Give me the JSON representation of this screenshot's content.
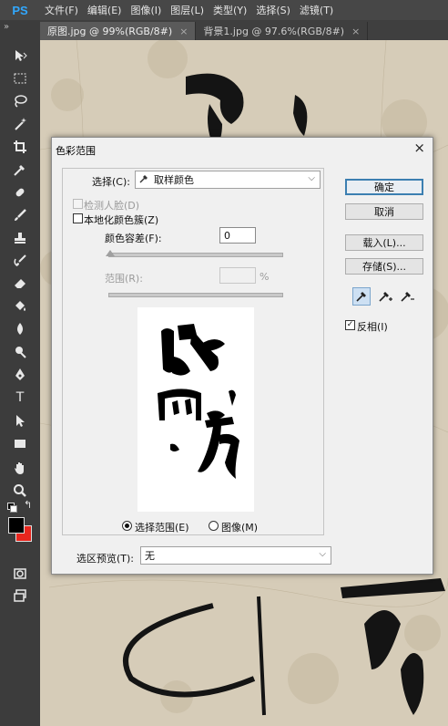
{
  "app": {
    "logo": "PS",
    "menu": [
      "文件(F)",
      "编辑(E)",
      "图像(I)",
      "图层(L)",
      "类型(Y)",
      "选择(S)",
      "滤镜(T)"
    ]
  },
  "tabs": [
    {
      "label": "原图.jpg @ 99%(RGB/8#)",
      "close": "×",
      "active": true
    },
    {
      "label": "背景1.jpg @ 97.6%(RGB/8#)",
      "close": "×",
      "active": false
    }
  ],
  "toolbar": {
    "expand": "»",
    "tools": [
      "move-tool",
      "marquee-tool",
      "lasso-tool",
      "magic-wand-tool",
      "crop-tool",
      "eyedropper-tool",
      "healing-brush-tool",
      "brush-tool",
      "clone-stamp-tool",
      "history-brush-tool",
      "eraser-tool",
      "paint-bucket-tool",
      "blur-tool",
      "dodge-tool",
      "pen-tool",
      "type-tool",
      "path-selection-tool",
      "rectangle-tool",
      "hand-tool",
      "zoom-tool"
    ],
    "type_glyph": "T",
    "foreground_color": "#000000",
    "background_color": "#e8261e"
  },
  "dialog": {
    "title": "色彩范围",
    "close": "×",
    "select_label": "选择(C):",
    "select_value": "取样颜色",
    "detect_faces_label": "检测人脸(D)",
    "localized_label": "本地化颜色簇(Z)",
    "fuzziness_label": "颜色容差(F):",
    "fuzziness_value": "0",
    "range_label": "范围(R):",
    "range_unit": "%",
    "selection_radio": "选择范围(E)",
    "image_radio": "图像(M)",
    "preview_label": "选区预览(T):",
    "preview_value": "无",
    "ok_button": "确定",
    "cancel_button": "取消",
    "load_button": "载入(L)...",
    "save_button": "存储(S)...",
    "invert_label": "反相(I)",
    "invert_checked": true
  }
}
